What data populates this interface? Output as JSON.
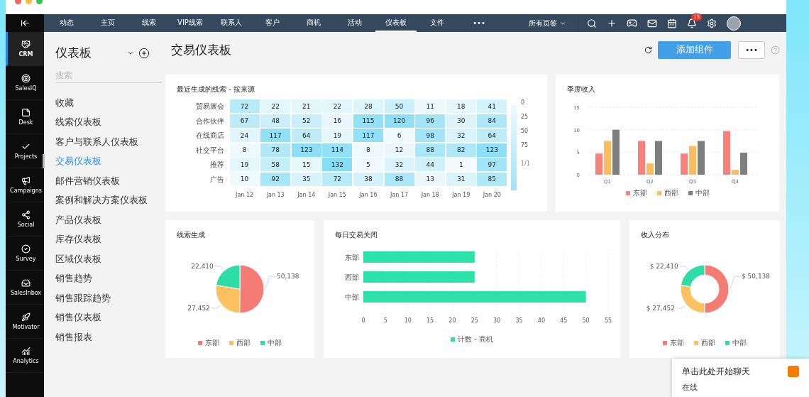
{
  "rail": {
    "items": [
      {
        "label": "CRM",
        "selected": true
      },
      {
        "label": "SalesIQ",
        "selected": false
      },
      {
        "label": "Desk",
        "selected": false
      },
      {
        "label": "Projects",
        "selected": false
      },
      {
        "label": "Campaigns",
        "selected": false
      },
      {
        "label": "Social",
        "selected": false
      },
      {
        "label": "Survey",
        "selected": false
      },
      {
        "label": "SalesInbox",
        "selected": false
      },
      {
        "label": "Motivator",
        "selected": false
      },
      {
        "label": "Analytics",
        "selected": false
      }
    ]
  },
  "nav": {
    "tabs": [
      {
        "label": "动态",
        "selected": false
      },
      {
        "label": "主页",
        "selected": false
      },
      {
        "label": "线索",
        "selected": false
      },
      {
        "label": "VIP线索",
        "selected": false
      },
      {
        "label": "联系人",
        "selected": false
      },
      {
        "label": "客户",
        "selected": false
      },
      {
        "label": "商机",
        "selected": false
      },
      {
        "label": "活动",
        "selected": false
      },
      {
        "label": "仪表板",
        "selected": true
      },
      {
        "label": "文件",
        "selected": false
      }
    ],
    "more": "•••",
    "all_tabs": "所有页签",
    "notification_count": "13"
  },
  "sidebar": {
    "title": "仪表板",
    "search": {
      "placeholder": "搜索"
    },
    "items": [
      {
        "label": "收藏",
        "selected": false
      },
      {
        "label": "线索仪表板",
        "selected": false
      },
      {
        "label": "客户与联系人仪表板",
        "selected": false
      },
      {
        "label": "交易仪表板",
        "selected": true
      },
      {
        "label": "邮件营销仪表板",
        "selected": false
      },
      {
        "label": "案例和解决方案仪表板",
        "selected": false
      },
      {
        "label": "产品仪表板",
        "selected": false
      },
      {
        "label": "库存仪表板",
        "selected": false
      },
      {
        "label": "区域仪表板",
        "selected": false
      },
      {
        "label": "销售趋势",
        "selected": false
      },
      {
        "label": "销售跟踪趋势",
        "selected": false
      },
      {
        "label": "销售仪表板",
        "selected": false
      },
      {
        "label": "销售报表",
        "selected": false
      }
    ]
  },
  "header": {
    "title": "交易仪表板",
    "add_button": "添加组件",
    "more_button": "•••"
  },
  "heatmap": {
    "title": "最近生成的线索 - 按来源",
    "columns": [
      "Jan 12",
      "Jan 13",
      "Jan 14",
      "Jan 15",
      "Jan 16",
      "Jan 17",
      "Jan 18",
      "Jan 19",
      "Jan 20"
    ],
    "rows": [
      {
        "label": "贸易展会",
        "values": [
          "72",
          "22",
          "21",
          "22",
          "28",
          "50",
          "11",
          "18",
          "41"
        ]
      },
      {
        "label": "合作伙伴",
        "values": [
          "67",
          "48",
          "52",
          "16",
          "115",
          "120",
          "96",
          "30",
          "84"
        ]
      },
      {
        "label": "在线商店",
        "values": [
          "24",
          "117",
          "64",
          "19",
          "117",
          "6",
          "98",
          "32",
          "64"
        ]
      },
      {
        "label": "社交平台",
        "values": [
          "8",
          "78",
          "123",
          "114",
          "8",
          "12",
          "88",
          "82",
          "123"
        ]
      },
      {
        "label": "推荐",
        "values": [
          "19",
          "58",
          "15",
          "132",
          "5",
          "32",
          "44",
          "1",
          "97"
        ]
      },
      {
        "label": "广告",
        "values": [
          "10",
          "92",
          "35",
          "72",
          "38",
          "88",
          "13",
          "31",
          "85"
        ]
      }
    ],
    "legend": [
      "0",
      "25",
      "50",
      "75"
    ],
    "pager": "1/1"
  },
  "quarterly": {
    "title": "季度收入",
    "chart_data": {
      "type": "bar",
      "grid": true,
      "categories": [
        "Q1",
        "Q2",
        "Q3",
        "Q4"
      ],
      "ylim": [
        0,
        15
      ],
      "yticks": [
        0,
        5,
        10,
        15
      ],
      "series": [
        {
          "name": "东部",
          "color": "#f8827a",
          "values": [
            4.7,
            7.5,
            4.7,
            9.7
          ]
        },
        {
          "name": "西部",
          "color": "#fdbd5f",
          "values": [
            7.5,
            2.5,
            6.4,
            1.1
          ]
        },
        {
          "name": "中部",
          "color": "#7f7f7f",
          "values": [
            10,
            7.5,
            7.5,
            4.9
          ]
        }
      ]
    }
  },
  "leads": {
    "title": "线索生成",
    "chart_data": {
      "type": "pie",
      "categories": [
        "东部",
        "西部",
        "中部"
      ],
      "values": [
        50138,
        27452,
        22410
      ],
      "colors": [
        "#f47c74",
        "#fdc25f",
        "#2ddda6"
      ],
      "value_labels": [
        "50,138",
        "27,452",
        "22,410"
      ]
    }
  },
  "daily": {
    "title": "每日交易关闭",
    "chart_data": {
      "type": "bar",
      "orientation": "horizontal",
      "grid": true,
      "categories": [
        "东部",
        "西部",
        "中部"
      ],
      "xlim": [
        0,
        55
      ],
      "xticks": [
        0,
        5,
        10,
        15,
        20,
        25,
        30,
        35,
        40,
        45,
        50,
        55
      ],
      "series": [
        {
          "name": "计数 - 商机",
          "color": "#2be3a8",
          "values": [
            25,
            25,
            50
          ]
        }
      ]
    }
  },
  "revenue": {
    "title": "收入分布",
    "chart_data": {
      "type": "donut",
      "categories": [
        "东部",
        "西部",
        "中部"
      ],
      "values": [
        50138,
        27452,
        22410
      ],
      "colors": [
        "#f47c74",
        "#fdc25f",
        "#2ddda6"
      ],
      "value_labels": [
        "$ 50,138",
        "$ 27,452",
        "$ 22,410"
      ]
    }
  },
  "chat": {
    "title": "单击此处开始聊天",
    "status": "在线"
  }
}
